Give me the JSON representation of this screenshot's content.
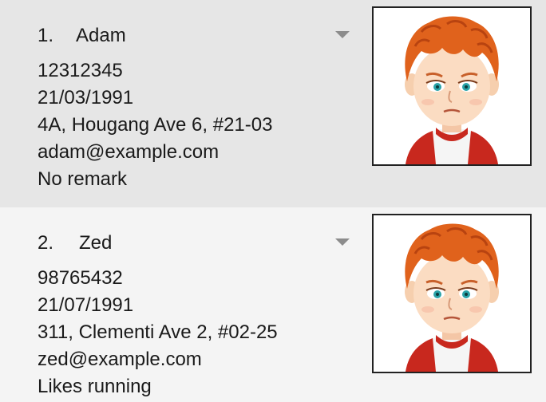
{
  "persons": [
    {
      "index": "1.",
      "name": "Adam",
      "phone": "12312345",
      "birthday": "21/03/1991",
      "address": "4A, Hougang Ave 6, #21-03",
      "email": "adam@example.com",
      "remark": "No remark",
      "avatar_icon": "cartoon-boy-avatar-icon"
    },
    {
      "index": "2.",
      "name": "Zed",
      "phone": "98765432",
      "birthday": "21/07/1991",
      "address": "311, Clementi Ave 2, #02-25",
      "email": "zed@example.com",
      "remark": "Likes running",
      "avatar_icon": "cartoon-boy-avatar-icon"
    }
  ],
  "colors": {
    "selected_card_bg": "#e6e6e6",
    "card_bg": "#f4f4f4",
    "text": "#1a1a1a",
    "arrow": "#8c8c8c",
    "hair": "#e0621c",
    "shirt_red": "#c8281e"
  },
  "icons": {
    "dropdown": "chevron-down-icon"
  }
}
